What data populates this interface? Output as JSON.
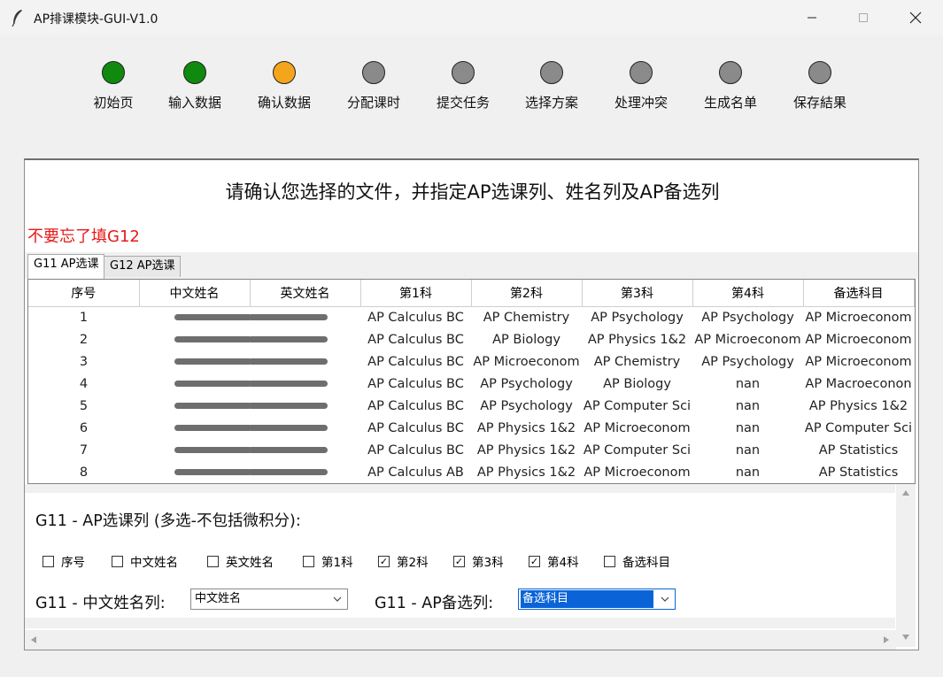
{
  "window": {
    "title": "AP排课模块-GUI-V1.0"
  },
  "steps": [
    {
      "label": "初始页",
      "color": "#0f8a0f"
    },
    {
      "label": "输入数据",
      "color": "#0f8a0f"
    },
    {
      "label": "确认数据",
      "color": "#f5a51c"
    },
    {
      "label": "分配课时",
      "color": "#8a8a8a"
    },
    {
      "label": "提交任务",
      "color": "#8a8a8a"
    },
    {
      "label": "选择方案",
      "color": "#8a8a8a"
    },
    {
      "label": "处理冲突",
      "color": "#8a8a8a"
    },
    {
      "label": "生成名单",
      "color": "#8a8a8a"
    },
    {
      "label": "保存結果",
      "color": "#8a8a8a"
    }
  ],
  "main": {
    "title": "请确认您选择的文件，并指定AP选课列、姓名列及AP备选列",
    "warning": "不要忘了填G12",
    "tabs": [
      "G11 AP选课",
      "G12 AP选课"
    ]
  },
  "table": {
    "headers": [
      "序号",
      "中文姓名",
      "英文姓名",
      "第1科",
      "第2科",
      "第3科",
      "第4科",
      "备选科目"
    ],
    "rows": [
      [
        "1",
        "",
        "",
        "AP Calculus BC",
        "AP Chemistry",
        "AP Psychology",
        "AP Psychology",
        "AP Microeconom"
      ],
      [
        "2",
        "",
        "",
        "AP Calculus BC",
        "AP Biology",
        "AP Physics 1&2",
        "AP Microeconom",
        "AP Microeconom"
      ],
      [
        "3",
        "",
        "",
        "AP Calculus BC",
        "AP Microeconom",
        "AP Chemistry",
        "AP Psychology",
        "AP Microeconom"
      ],
      [
        "4",
        "",
        "",
        "AP Calculus BC",
        "AP Psychology",
        "AP Biology",
        "nan",
        "AP Macroeconon"
      ],
      [
        "5",
        "",
        "",
        "AP Calculus BC",
        "AP Psychology",
        "AP Computer Sci",
        "nan",
        "AP Physics 1&2"
      ],
      [
        "6",
        "",
        "",
        "AP Calculus BC",
        "AP Physics 1&2",
        "AP Microeconom",
        "nan",
        "AP Computer Sci"
      ],
      [
        "7",
        "",
        "",
        "AP Calculus BC",
        "AP Physics 1&2",
        "AP Computer Sci",
        "nan",
        "AP Statistics"
      ],
      [
        "8",
        "",
        "",
        "AP Calculus AB",
        "AP Physics 1&2",
        "AP Microeconom",
        "nan",
        "AP Statistics"
      ]
    ]
  },
  "form": {
    "section_label": "G11 - AP选课列 (多选-不包括微积分):",
    "checkboxes": [
      {
        "label": "序号",
        "checked": false
      },
      {
        "label": "中文姓名",
        "checked": false
      },
      {
        "label": "英文姓名",
        "checked": false
      },
      {
        "label": "第1科",
        "checked": false
      },
      {
        "label": "第2科",
        "checked": true
      },
      {
        "label": "第3科",
        "checked": true
      },
      {
        "label": "第4科",
        "checked": true
      },
      {
        "label": "备选科目",
        "checked": false
      }
    ],
    "name_col_label": "G11 - 中文姓名列:",
    "name_col_value": "中文姓名",
    "alt_col_label": "G11 - AP备选列:",
    "alt_col_value": "备选科目"
  }
}
